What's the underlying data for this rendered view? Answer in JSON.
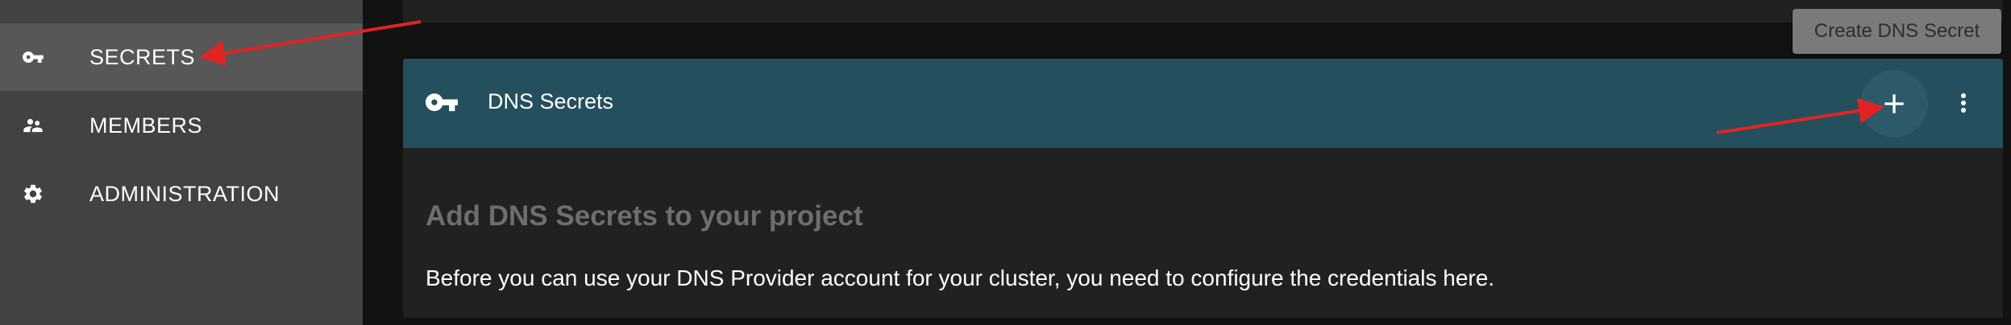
{
  "sidebar": {
    "items": [
      {
        "label": "SECRETS",
        "icon": "key-icon",
        "active": true
      },
      {
        "label": "MEMBERS",
        "icon": "people-icon",
        "active": false
      },
      {
        "label": "ADMINISTRATION",
        "icon": "gear-icon",
        "active": false
      }
    ]
  },
  "toolbar": {
    "create_label": "Create DNS Secret"
  },
  "card": {
    "title": "DNS Secrets",
    "add_icon": "plus-icon",
    "more_icon": "more-vertical-icon",
    "empty_title": "Add DNS Secrets to your project",
    "empty_text": "Before you can use your DNS Provider account for your cluster, you need to configure the credentials here."
  },
  "colors": {
    "sidebar_bg": "#424242",
    "sidebar_active_bg": "#575757",
    "card_header_bg": "#244f5c",
    "card_bg": "#212121",
    "page_bg": "#121212",
    "annotation_arrow": "#e02424"
  }
}
